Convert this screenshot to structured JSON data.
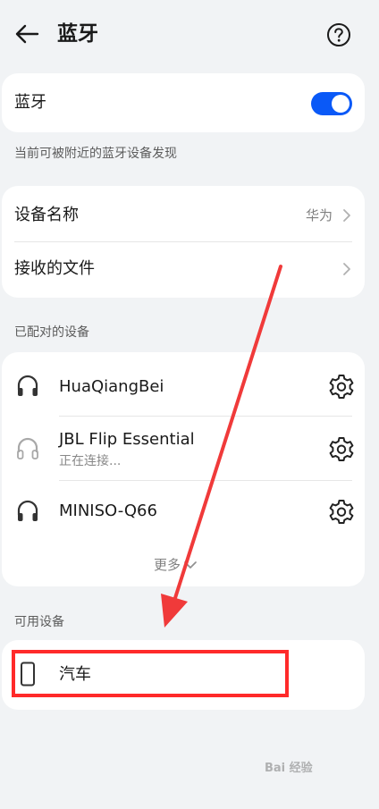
{
  "header": {
    "title": "蓝牙",
    "back_icon": "arrow-left-icon",
    "help_icon": "question-circle-icon"
  },
  "bluetooth": {
    "label": "蓝牙",
    "enabled": true,
    "visibility_note": "当前可被附近的蓝牙设备发现"
  },
  "settings": {
    "device_name_label": "设备名称",
    "device_name_value": "华为",
    "received_files_label": "接收的文件"
  },
  "paired": {
    "section_label": "已配对的设备",
    "devices": [
      {
        "name": "HuaQiangBei",
        "status": "",
        "icon": "headphones-icon"
      },
      {
        "name": "JBL Flip Essential",
        "status": "正在连接...",
        "icon": "headphones-icon"
      },
      {
        "name": "MINISO-Q66",
        "status": "",
        "icon": "headphones-icon"
      }
    ],
    "more_label": "更多"
  },
  "available": {
    "section_label": "可用设备",
    "devices": [
      {
        "name": "汽车",
        "icon": "phone-icon"
      }
    ]
  },
  "watermark": "Bai 经验",
  "colors": {
    "accent": "#0a59f7",
    "annotation": "#ff2a2a",
    "background": "#f1f3f5"
  }
}
